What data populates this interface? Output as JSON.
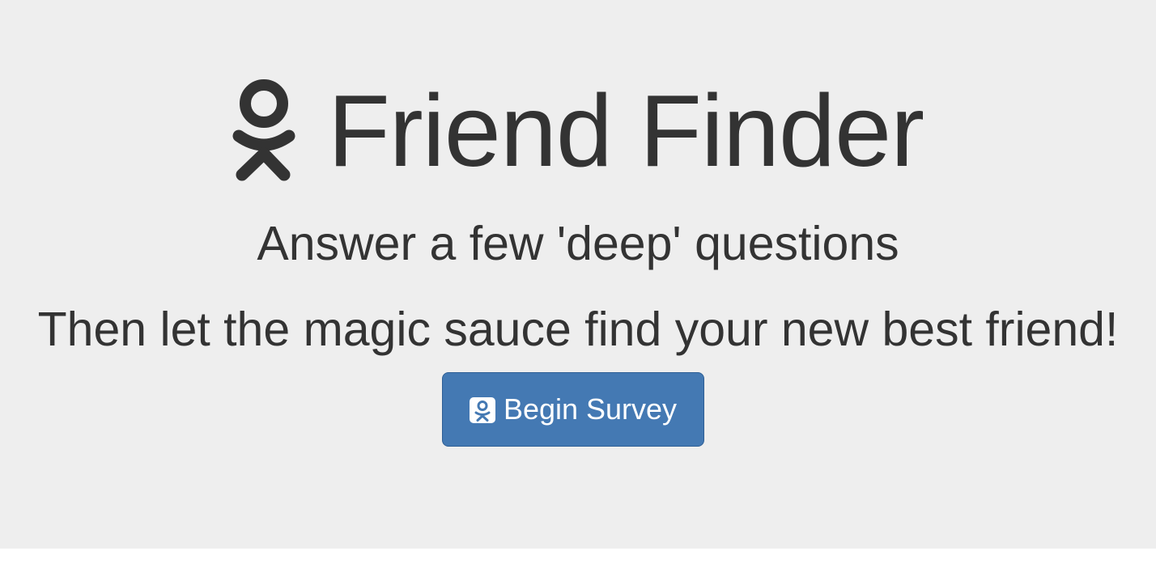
{
  "header": {
    "icon": "odnoklassniki-icon",
    "title": "Friend Finder"
  },
  "tagline": {
    "line1": "Answer a few 'deep' questions",
    "line2": "Then let the magic sauce find your new best friend!"
  },
  "cta": {
    "icon": "odnoklassniki-square-icon",
    "label": "Begin Survey"
  },
  "colors": {
    "background": "#eeeeee",
    "text": "#333333",
    "button": "#4479b3"
  }
}
